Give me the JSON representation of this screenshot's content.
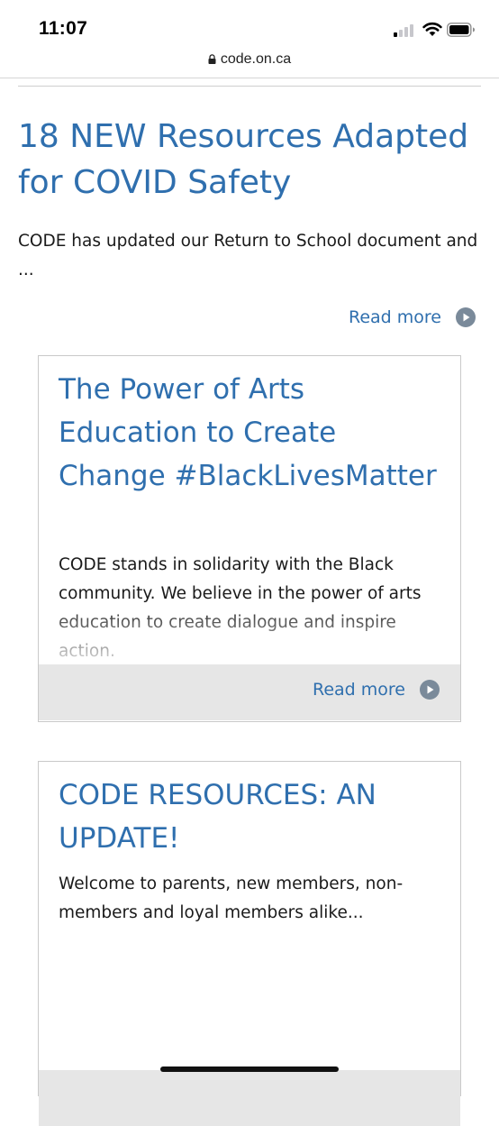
{
  "status_bar": {
    "time": "11:07"
  },
  "browser": {
    "url": "code.on.ca"
  },
  "articles": [
    {
      "title": "18 NEW Resources Adapted for COVID Safety",
      "excerpt": "CODE has updated our Return to School document and ...",
      "read_more": "Read more"
    },
    {
      "title": "The Power of Arts Education to Create Change #BlackLivesMatter",
      "excerpt": "CODE stands in solidarity with the Black community. We believe in the power of arts education to create dialogue and inspire action.",
      "read_more": "Read more"
    },
    {
      "title": "CODE RESOURCES: AN UPDATE!",
      "excerpt": "Welcome to parents, new members, non-members and loyal members alike..."
    }
  ],
  "colors": {
    "link": "#2f6fae",
    "icon": "#7a8a9a",
    "card_footer": "#e6e6e6"
  },
  "icons": [
    "lock-icon",
    "wifi-icon",
    "battery-icon",
    "cellular-signal-icon",
    "play-circle-icon"
  ]
}
